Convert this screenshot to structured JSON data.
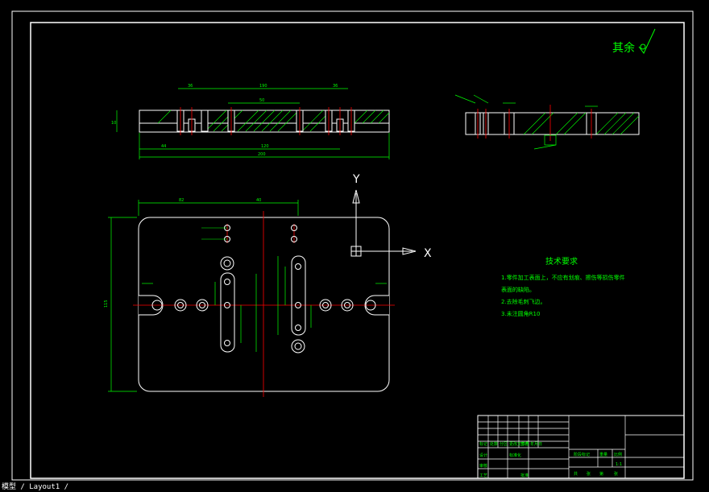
{
  "colors": {
    "background": "#000000",
    "outline": "#ffffff",
    "dimension": "#00ff00",
    "centerline": "#ff0000",
    "text": "#00ff00"
  },
  "roughness_symbol": "其余",
  "ucs": {
    "y_label": "Y",
    "x_label": "X"
  },
  "tech_requirements": {
    "title": "技术要求",
    "items": [
      "1.零件加工表面上，不应有划痕、擦伤等损伤零件",
      "表面的缺陷。",
      "2.去除毛刺飞边。",
      "3.未注圆角R10"
    ]
  },
  "title_block": {
    "labels": [
      "标记",
      "处数",
      "分区",
      "更改文件号",
      "签名",
      "年月日",
      "设计",
      "标准化",
      "审核",
      "工艺",
      "批准",
      "阶段标记",
      "重量",
      "比例",
      "共",
      "张",
      "第",
      "张"
    ],
    "scale": "1:1"
  },
  "status_bar": {
    "text": "模型 / Layout1 /"
  }
}
